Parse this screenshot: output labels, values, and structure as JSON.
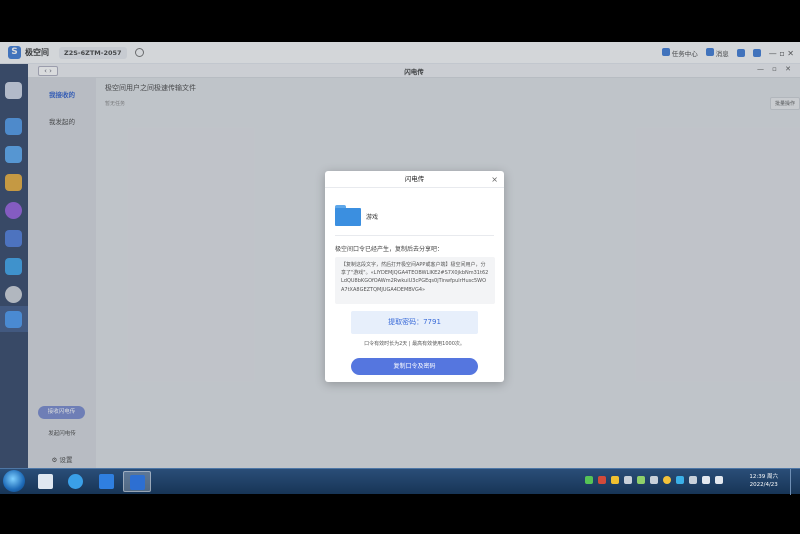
{
  "topbar": {
    "app_name": "极空间",
    "device": "Z2S-6ZTM-2057",
    "task_center": "任务中心",
    "messages": "消息",
    "window_controls": "— ▫ ✕"
  },
  "app": {
    "title": "闪电传",
    "back_label": "‹ ›",
    "controls": "— ▫ ✕",
    "sidebar": {
      "received": "我接收的",
      "sent": "我发起的",
      "receive_btn": "接收闪电传",
      "send_link": "发起闪电传",
      "settings": "设置"
    },
    "main": {
      "heading": "极空间用户之间极速传输文件",
      "sub": "暂无任务",
      "batch": "批量操作"
    }
  },
  "dialog": {
    "title": "闪电传",
    "close": "×",
    "file_name": "游戏",
    "hint": "极空间口令已经产生，复制后去分享吧：",
    "share_text": "【复制这段文字，然后打开极空间APP或客户端】极空间用户，分享了\"游戏\"。«LIYDEMJQGA4TEOBWLIKE2#S7X0jkbNm31t62LdQU8bKGOfOAWm2RwkuiU3cPGEqs0jTinwfpulrHusc5WOA7tXA8GEZTQMJUGA4DEMBVG4»",
    "code_label": "提取密码：7791",
    "validity": "口令有效时长为2天 | 最高有效使用1000次。",
    "copy_button": "复制口令及密码"
  },
  "taskbar": {
    "time": "12:39 周六",
    "date": "2022/4/23"
  },
  "colors": {
    "accent": "#5576df",
    "dock": "#20355b",
    "code_bg": "#e7effb"
  }
}
